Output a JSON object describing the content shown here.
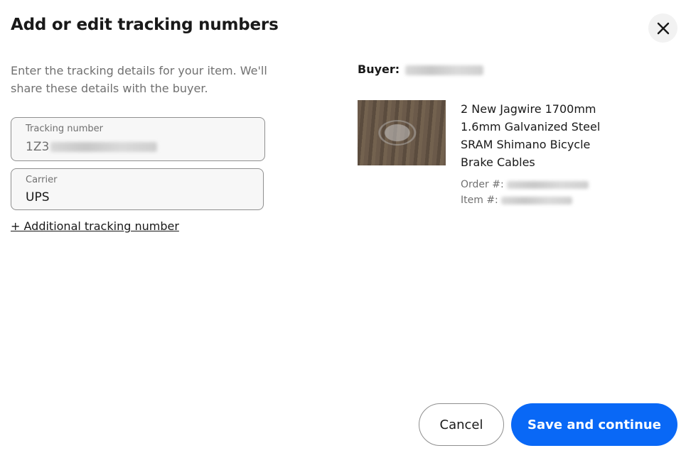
{
  "dialog": {
    "title": "Add or edit tracking numbers",
    "close_icon": "close-icon"
  },
  "intro": "Enter the tracking details for your item. We'll share these details with the buyer.",
  "tracking": {
    "label": "Tracking number",
    "value_prefix": "1Z3"
  },
  "carrier": {
    "label": "Carrier",
    "value": "UPS"
  },
  "add_tracking_link": "+ Additional tracking number",
  "buyer": {
    "label": "Buyer:"
  },
  "item": {
    "title": "2 New Jagwire 1700mm 1.6mm Galvanized Steel SRAM Shimano Bicycle Brake Cables",
    "order_label": "Order #:",
    "item_label": "Item #:"
  },
  "buttons": {
    "cancel": "Cancel",
    "save": "Save and continue"
  },
  "colors": {
    "primary": "#0968f6",
    "text": "#191919",
    "muted": "#707070"
  }
}
